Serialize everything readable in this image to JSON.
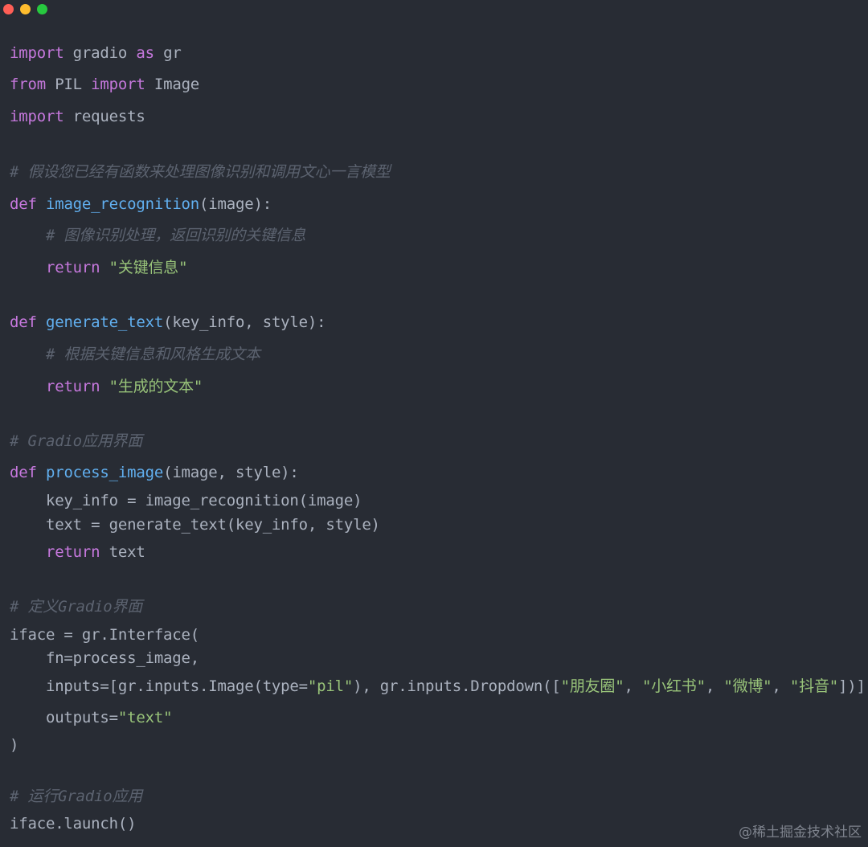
{
  "window": {
    "buttons": {
      "close": "close",
      "minimize": "minimize",
      "zoom": "zoom"
    }
  },
  "code": {
    "lines": [
      [
        {
          "t": "import",
          "c": "kw"
        },
        {
          "t": " gradio ",
          "c": "plain"
        },
        {
          "t": "as",
          "c": "kw"
        },
        {
          "t": " gr",
          "c": "plain"
        }
      ],
      [
        {
          "t": "from",
          "c": "kw"
        },
        {
          "t": " PIL ",
          "c": "plain"
        },
        {
          "t": "import",
          "c": "kw"
        },
        {
          "t": " Image",
          "c": "plain"
        }
      ],
      [
        {
          "t": "import",
          "c": "kw"
        },
        {
          "t": " requests",
          "c": "plain"
        }
      ],
      [
        {
          "t": "# 假设您已经有函数来处理图像识别和调用文心一言模型",
          "c": "cmt"
        }
      ],
      [
        {
          "t": "def",
          "c": "kw"
        },
        {
          "t": " ",
          "c": "plain"
        },
        {
          "t": "image_recognition",
          "c": "fn"
        },
        {
          "t": "(image):",
          "c": "plain"
        }
      ],
      [
        {
          "t": "    # 图像识别处理，返回识别的关键信息",
          "c": "cmt"
        }
      ],
      [
        {
          "t": "    ",
          "c": "plain"
        },
        {
          "t": "return",
          "c": "kw"
        },
        {
          "t": " ",
          "c": "plain"
        },
        {
          "t": "\"关键信息\"",
          "c": "str"
        }
      ],
      [
        {
          "t": "def",
          "c": "kw"
        },
        {
          "t": " ",
          "c": "plain"
        },
        {
          "t": "generate_text",
          "c": "fn"
        },
        {
          "t": "(key_info, style):",
          "c": "plain"
        }
      ],
      [
        {
          "t": "    # 根据关键信息和风格生成文本",
          "c": "cmt"
        }
      ],
      [
        {
          "t": "    ",
          "c": "plain"
        },
        {
          "t": "return",
          "c": "kw"
        },
        {
          "t": " ",
          "c": "plain"
        },
        {
          "t": "\"生成的文本\"",
          "c": "str"
        }
      ],
      [
        {
          "t": "# Gradio应用界面",
          "c": "cmt"
        }
      ],
      [
        {
          "t": "def",
          "c": "kw"
        },
        {
          "t": " ",
          "c": "plain"
        },
        {
          "t": "process_image",
          "c": "fn"
        },
        {
          "t": "(image, style):",
          "c": "plain"
        }
      ],
      [
        {
          "t": "    key_info = image_recognition(image)",
          "c": "plain"
        }
      ],
      [
        {
          "t": "    text = generate_text(key_info, style)",
          "c": "plain"
        }
      ],
      [
        {
          "t": "    ",
          "c": "plain"
        },
        {
          "t": "return",
          "c": "kw"
        },
        {
          "t": " text",
          "c": "plain"
        }
      ],
      [
        {
          "t": "# 定义Gradio界面",
          "c": "cmt"
        }
      ],
      [
        {
          "t": "iface = gr.Interface(",
          "c": "plain"
        }
      ],
      [
        {
          "t": "    fn=process_image,",
          "c": "plain"
        }
      ],
      [
        {
          "t": "    inputs=[gr.inputs.Image(type=",
          "c": "plain"
        },
        {
          "t": "\"pil\"",
          "c": "str"
        },
        {
          "t": "), gr.inputs.Dropdown([",
          "c": "plain"
        },
        {
          "t": "\"朋友圈\"",
          "c": "str"
        },
        {
          "t": ", ",
          "c": "plain"
        },
        {
          "t": "\"小红书\"",
          "c": "str"
        },
        {
          "t": ", ",
          "c": "plain"
        },
        {
          "t": "\"微博\"",
          "c": "str"
        },
        {
          "t": ", ",
          "c": "plain"
        },
        {
          "t": "\"抖音\"",
          "c": "str"
        },
        {
          "t": "])],",
          "c": "plain"
        }
      ],
      [
        {
          "t": "    outputs=",
          "c": "plain"
        },
        {
          "t": "\"text\"",
          "c": "str"
        }
      ],
      [
        {
          "t": ")",
          "c": "plain"
        }
      ],
      [
        {
          "t": "# 运行Gradio应用",
          "c": "cmt"
        }
      ],
      [
        {
          "t": "iface.launch()",
          "c": "plain"
        }
      ]
    ]
  },
  "watermark": "@稀土掘金技术社区"
}
